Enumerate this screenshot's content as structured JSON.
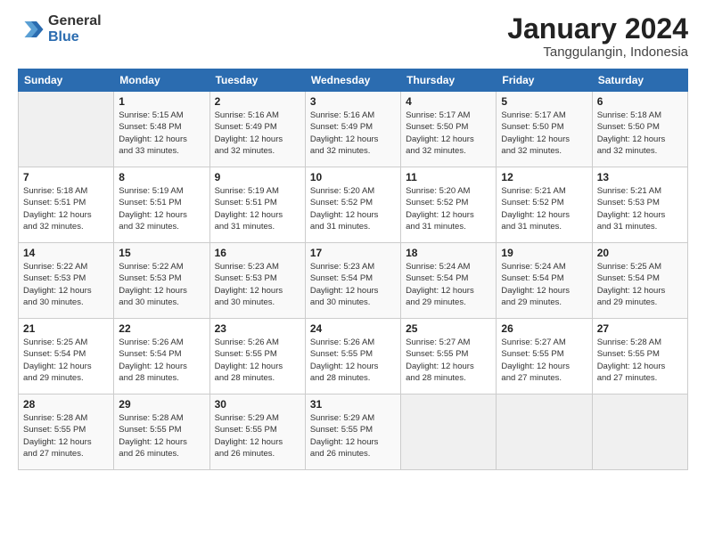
{
  "logo": {
    "general": "General",
    "blue": "Blue"
  },
  "header": {
    "title": "January 2024",
    "subtitle": "Tanggulangin, Indonesia"
  },
  "days_of_week": [
    "Sunday",
    "Monday",
    "Tuesday",
    "Wednesday",
    "Thursday",
    "Friday",
    "Saturday"
  ],
  "weeks": [
    [
      {
        "day": "",
        "info": ""
      },
      {
        "day": "1",
        "info": "Sunrise: 5:15 AM\nSunset: 5:48 PM\nDaylight: 12 hours\nand 33 minutes."
      },
      {
        "day": "2",
        "info": "Sunrise: 5:16 AM\nSunset: 5:49 PM\nDaylight: 12 hours\nand 32 minutes."
      },
      {
        "day": "3",
        "info": "Sunrise: 5:16 AM\nSunset: 5:49 PM\nDaylight: 12 hours\nand 32 minutes."
      },
      {
        "day": "4",
        "info": "Sunrise: 5:17 AM\nSunset: 5:50 PM\nDaylight: 12 hours\nand 32 minutes."
      },
      {
        "day": "5",
        "info": "Sunrise: 5:17 AM\nSunset: 5:50 PM\nDaylight: 12 hours\nand 32 minutes."
      },
      {
        "day": "6",
        "info": "Sunrise: 5:18 AM\nSunset: 5:50 PM\nDaylight: 12 hours\nand 32 minutes."
      }
    ],
    [
      {
        "day": "7",
        "info": "Sunrise: 5:18 AM\nSunset: 5:51 PM\nDaylight: 12 hours\nand 32 minutes."
      },
      {
        "day": "8",
        "info": "Sunrise: 5:19 AM\nSunset: 5:51 PM\nDaylight: 12 hours\nand 32 minutes."
      },
      {
        "day": "9",
        "info": "Sunrise: 5:19 AM\nSunset: 5:51 PM\nDaylight: 12 hours\nand 31 minutes."
      },
      {
        "day": "10",
        "info": "Sunrise: 5:20 AM\nSunset: 5:52 PM\nDaylight: 12 hours\nand 31 minutes."
      },
      {
        "day": "11",
        "info": "Sunrise: 5:20 AM\nSunset: 5:52 PM\nDaylight: 12 hours\nand 31 minutes."
      },
      {
        "day": "12",
        "info": "Sunrise: 5:21 AM\nSunset: 5:52 PM\nDaylight: 12 hours\nand 31 minutes."
      },
      {
        "day": "13",
        "info": "Sunrise: 5:21 AM\nSunset: 5:53 PM\nDaylight: 12 hours\nand 31 minutes."
      }
    ],
    [
      {
        "day": "14",
        "info": "Sunrise: 5:22 AM\nSunset: 5:53 PM\nDaylight: 12 hours\nand 30 minutes."
      },
      {
        "day": "15",
        "info": "Sunrise: 5:22 AM\nSunset: 5:53 PM\nDaylight: 12 hours\nand 30 minutes."
      },
      {
        "day": "16",
        "info": "Sunrise: 5:23 AM\nSunset: 5:53 PM\nDaylight: 12 hours\nand 30 minutes."
      },
      {
        "day": "17",
        "info": "Sunrise: 5:23 AM\nSunset: 5:54 PM\nDaylight: 12 hours\nand 30 minutes."
      },
      {
        "day": "18",
        "info": "Sunrise: 5:24 AM\nSunset: 5:54 PM\nDaylight: 12 hours\nand 29 minutes."
      },
      {
        "day": "19",
        "info": "Sunrise: 5:24 AM\nSunset: 5:54 PM\nDaylight: 12 hours\nand 29 minutes."
      },
      {
        "day": "20",
        "info": "Sunrise: 5:25 AM\nSunset: 5:54 PM\nDaylight: 12 hours\nand 29 minutes."
      }
    ],
    [
      {
        "day": "21",
        "info": "Sunrise: 5:25 AM\nSunset: 5:54 PM\nDaylight: 12 hours\nand 29 minutes."
      },
      {
        "day": "22",
        "info": "Sunrise: 5:26 AM\nSunset: 5:54 PM\nDaylight: 12 hours\nand 28 minutes."
      },
      {
        "day": "23",
        "info": "Sunrise: 5:26 AM\nSunset: 5:55 PM\nDaylight: 12 hours\nand 28 minutes."
      },
      {
        "day": "24",
        "info": "Sunrise: 5:26 AM\nSunset: 5:55 PM\nDaylight: 12 hours\nand 28 minutes."
      },
      {
        "day": "25",
        "info": "Sunrise: 5:27 AM\nSunset: 5:55 PM\nDaylight: 12 hours\nand 28 minutes."
      },
      {
        "day": "26",
        "info": "Sunrise: 5:27 AM\nSunset: 5:55 PM\nDaylight: 12 hours\nand 27 minutes."
      },
      {
        "day": "27",
        "info": "Sunrise: 5:28 AM\nSunset: 5:55 PM\nDaylight: 12 hours\nand 27 minutes."
      }
    ],
    [
      {
        "day": "28",
        "info": "Sunrise: 5:28 AM\nSunset: 5:55 PM\nDaylight: 12 hours\nand 27 minutes."
      },
      {
        "day": "29",
        "info": "Sunrise: 5:28 AM\nSunset: 5:55 PM\nDaylight: 12 hours\nand 26 minutes."
      },
      {
        "day": "30",
        "info": "Sunrise: 5:29 AM\nSunset: 5:55 PM\nDaylight: 12 hours\nand 26 minutes."
      },
      {
        "day": "31",
        "info": "Sunrise: 5:29 AM\nSunset: 5:55 PM\nDaylight: 12 hours\nand 26 minutes."
      },
      {
        "day": "",
        "info": ""
      },
      {
        "day": "",
        "info": ""
      },
      {
        "day": "",
        "info": ""
      }
    ]
  ]
}
